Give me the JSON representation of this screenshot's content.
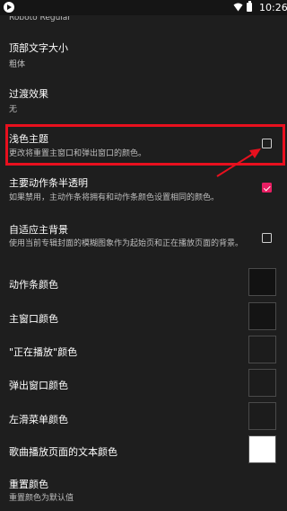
{
  "status_bar": {
    "time": "10:26",
    "app_icon": "play-icon",
    "wifi_icon": "wifi-icon",
    "battery_icon": "battery-icon"
  },
  "settings": {
    "font_summary": "Roboto Regular",
    "top_text_size": {
      "title": "顶部文字大小",
      "summary": "粗体"
    },
    "transition_effect": {
      "title": "过渡效果",
      "summary": "无"
    },
    "light_theme": {
      "title": "浅色主题",
      "summary": "更改将重置主窗口和弹出窗口的颜色。",
      "checked": false
    },
    "translucent_action_bar": {
      "title": "主要动作条半透明",
      "summary": "如果禁用，主动作条将拥有和动作条颜色设置相同的颜色。",
      "checked": true
    },
    "adaptive_background": {
      "title": "自适应主背景",
      "summary": "使用当前专辑封面的模糊图象作为起始页和正在播放页面的背景。",
      "checked": false
    },
    "action_bar_color": {
      "title": "动作条颜色",
      "color": "#121212"
    },
    "main_window_color": {
      "title": "主窗口颜色",
      "color": "#141414"
    },
    "now_playing_color": {
      "title": "\"正在播放\"颜色",
      "color": "#1c1c1c"
    },
    "popup_window_color": {
      "title": "弹出窗口颜色",
      "color": "#1c1c1c"
    },
    "side_menu_color": {
      "title": "左滑菜单颜色",
      "color": "#1c1c1c"
    },
    "song_text_color": {
      "title": "歌曲播放页面的文本颜色",
      "color": "#ffffff"
    },
    "reset_colors": {
      "title": "重置颜色",
      "summary": "重置颜色为默认值"
    }
  },
  "colors": {
    "background": "#1e1e1e",
    "accent": "#e91e63",
    "highlight": "#e8101e"
  }
}
